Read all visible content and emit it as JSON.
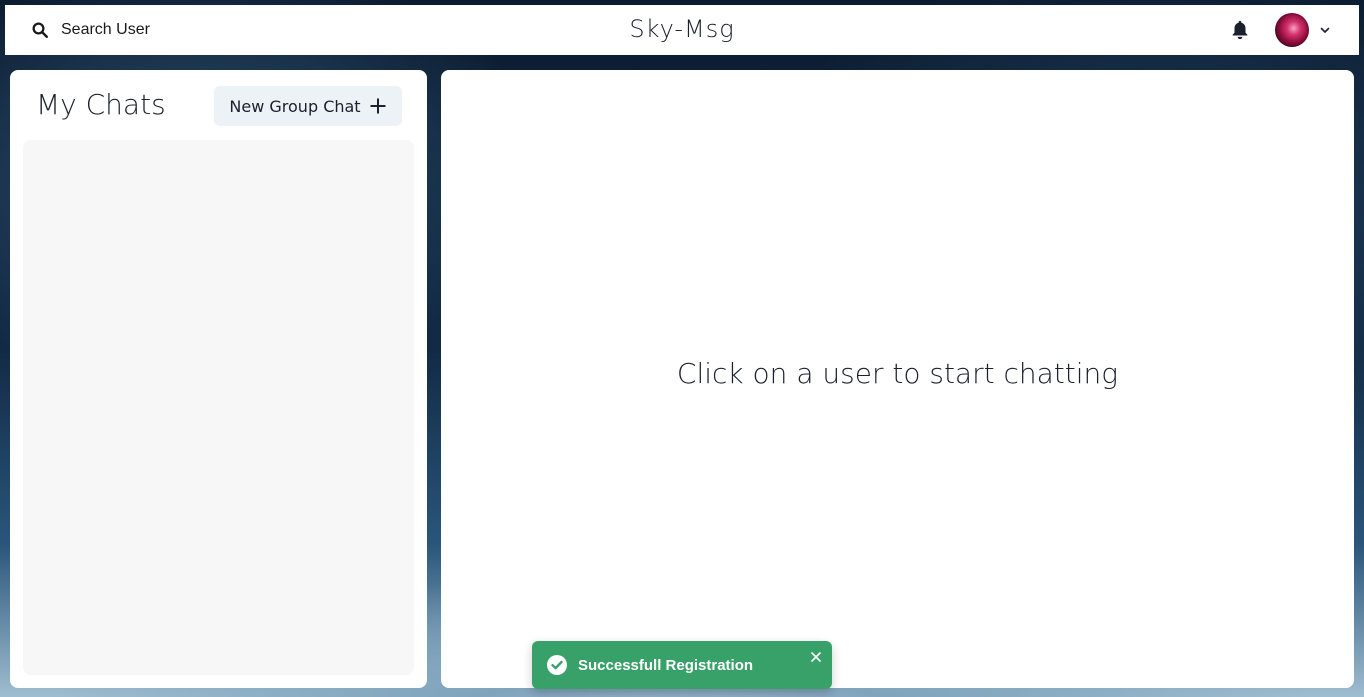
{
  "header": {
    "search_label": "Search User",
    "app_title": "Sky-Msg",
    "icons": {
      "search": "search-icon",
      "notifications": "bell-icon",
      "profile_menu": "chevron-down-icon"
    }
  },
  "sidebar": {
    "title": "My Chats",
    "new_group_button": "New Group Chat",
    "new_group_icon": "plus-icon",
    "chats": []
  },
  "main": {
    "placeholder": "Click on a user to start chatting"
  },
  "toast": {
    "status": "success",
    "message": "Successfull Registration",
    "color": "#38a169"
  }
}
